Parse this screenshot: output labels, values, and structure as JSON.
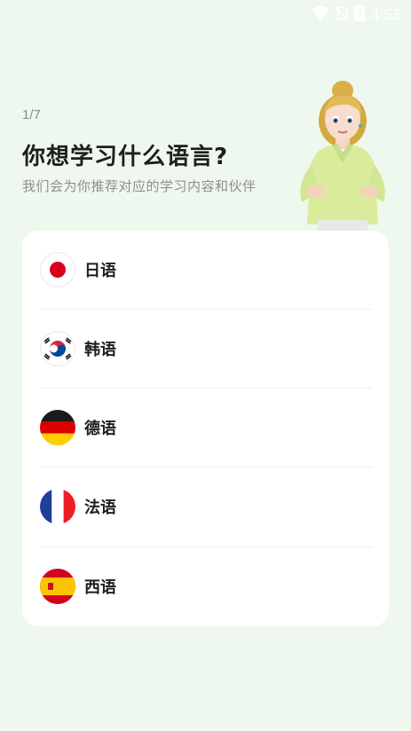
{
  "status_bar": {
    "time": "4:55",
    "icons": [
      "wifi-icon",
      "no-sim-icon",
      "battery-charging-icon"
    ]
  },
  "header": {
    "step": "1/7",
    "title": "你想学习什么语言?",
    "subtitle": "我们会为你推荐对应的学习内容和伙伴"
  },
  "languages": [
    {
      "label": "日语",
      "flag": "japan-flag-icon"
    },
    {
      "label": "韩语",
      "flag": "south-korea-flag-icon"
    },
    {
      "label": "德语",
      "flag": "germany-flag-icon"
    },
    {
      "label": "法语",
      "flag": "france-flag-icon"
    },
    {
      "label": "西语",
      "flag": "spain-flag-icon"
    }
  ],
  "colors": {
    "background": "#eef8ee",
    "card": "#ffffff",
    "text": "#1e1e1e",
    "muted": "#8c8f8c"
  }
}
